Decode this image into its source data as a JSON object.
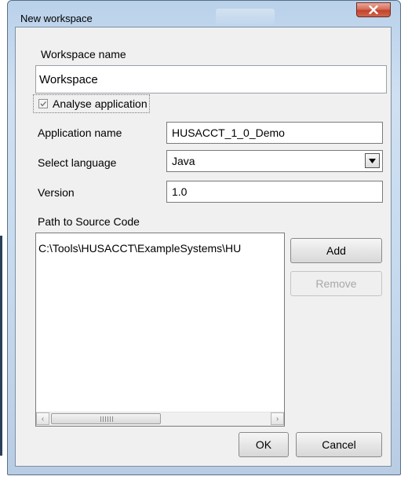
{
  "window": {
    "title": "New workspace",
    "close_icon": "close-icon"
  },
  "workspace": {
    "label": "Workspace name",
    "value": "Workspace"
  },
  "analyse": {
    "label": "Analyse application",
    "checked": true
  },
  "app": {
    "name_label": "Application name",
    "name_value": "HUSACCT_1_0_Demo",
    "language_label": "Select language",
    "language_value": "Java",
    "version_label": "Version",
    "version_value": "1.0"
  },
  "source": {
    "label": "Path to Source Code",
    "paths": [
      "C:\\Tools\\HUSACCT\\ExampleSystems\\HU"
    ],
    "add_label": "Add",
    "remove_label": "Remove"
  },
  "footer": {
    "ok_label": "OK",
    "cancel_label": "Cancel"
  }
}
